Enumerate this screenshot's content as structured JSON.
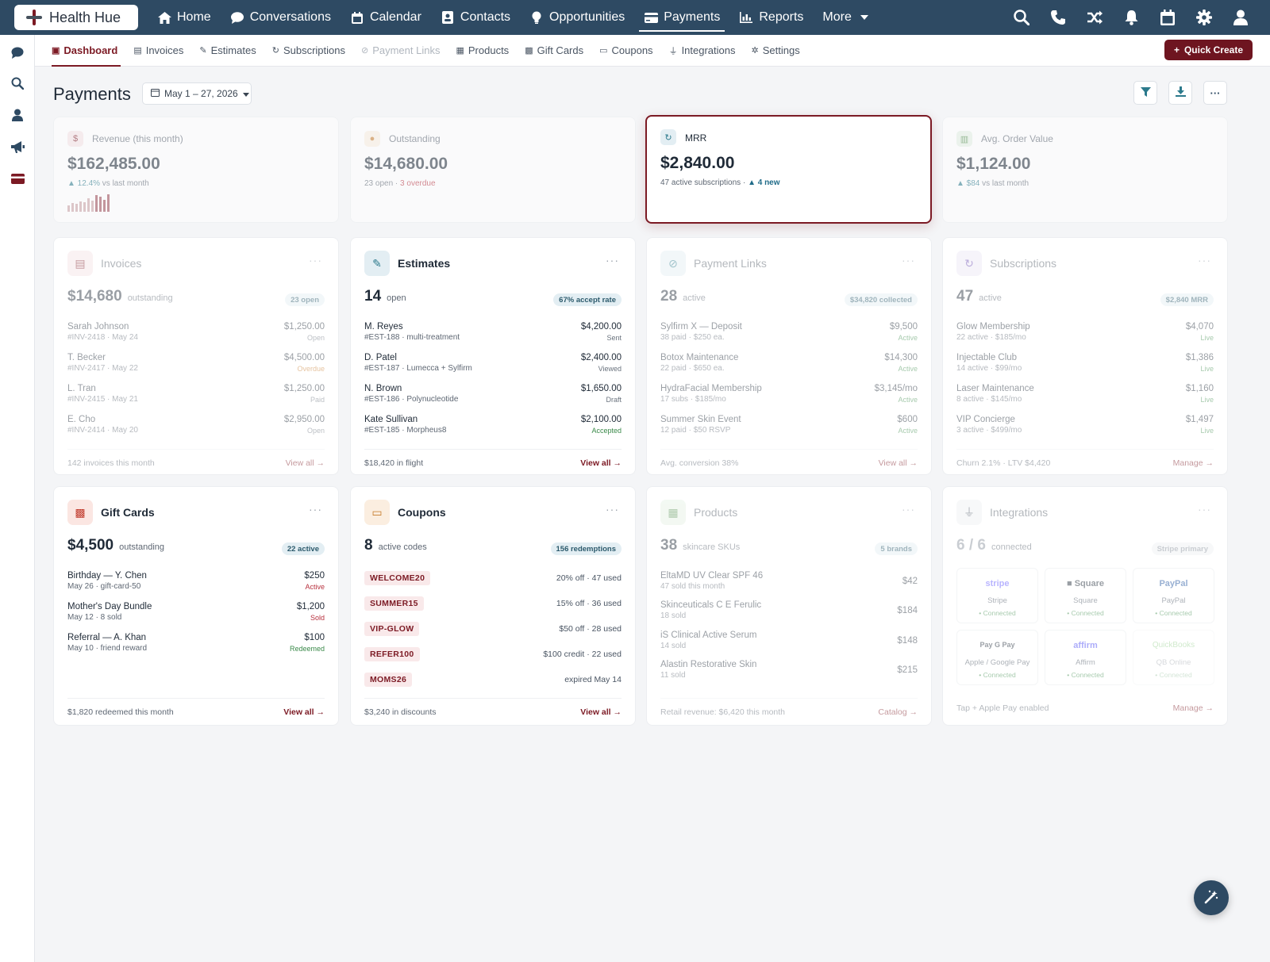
{
  "brand": {
    "name": "Health Hue"
  },
  "topnav": {
    "items": [
      {
        "label": "Home",
        "icon": "home-icon"
      },
      {
        "label": "Conversations",
        "icon": "chat-icon"
      },
      {
        "label": "Calendar",
        "icon": "calendar-icon"
      },
      {
        "label": "Contacts",
        "icon": "contact-card-icon"
      },
      {
        "label": "Opportunities",
        "icon": "lightbulb-icon"
      },
      {
        "label": "Payments",
        "icon": "credit-card-icon",
        "active": true
      },
      {
        "label": "Reports",
        "icon": "bar-chart-icon"
      },
      {
        "label": "More",
        "icon": "caret-down-icon"
      }
    ],
    "actions": [
      "search-icon",
      "phone-icon",
      "shuffle-icon",
      "bell-icon",
      "calendar-icon",
      "gear-icon",
      "user-icon"
    ]
  },
  "subnav": {
    "items": [
      {
        "label": "Dashboard",
        "active": true
      },
      {
        "label": "Invoices"
      },
      {
        "label": "Estimates"
      },
      {
        "label": "Subscriptions"
      },
      {
        "label": "Payment Links",
        "dim": true
      },
      {
        "label": "Products"
      },
      {
        "label": "Gift Cards"
      },
      {
        "label": "Coupons"
      },
      {
        "label": "Integrations"
      },
      {
        "label": "Settings"
      }
    ],
    "quick_create": "Quick Create"
  },
  "page": {
    "title": "Payments",
    "date_range": "May 1 – 27, 2026"
  },
  "kpis": {
    "revenue": {
      "label": "Revenue (this month)",
      "value": "$162,485.00",
      "delta": "▲ 12.4%",
      "delta_suffix": " vs last month",
      "spark": [
        0.35,
        0.5,
        0.45,
        0.6,
        0.55,
        0.75,
        0.65,
        0.95,
        0.85,
        0.7,
        1.0
      ]
    },
    "outstanding": {
      "label": "Outstanding",
      "value": "$14,680.00",
      "sub": "23 open · ",
      "overdue": "3 overdue"
    },
    "mrr": {
      "label": "MRR",
      "value": "$2,840.00",
      "sub": "47 active subscriptions · ",
      "new": "▲ 4 new"
    },
    "aov": {
      "label": "Avg. Order Value",
      "value": "$1,124.00",
      "delta": "▲ $84",
      "delta_suffix": " vs last month"
    }
  },
  "invoices": {
    "title": "Invoices",
    "big": "$14,680",
    "big_sub": "outstanding",
    "pill": "23 open",
    "rows": [
      {
        "name": "Sarah Johnson",
        "meta": "#INV-2418 · May 24",
        "amount": "$1,250.00",
        "status": "Open"
      },
      {
        "name": "T. Becker",
        "meta": "#INV-2417 · May 22",
        "amount": "$4,500.00",
        "status": "Overdue"
      },
      {
        "name": "L. Tran",
        "meta": "#INV-2415 · May 21",
        "amount": "$1,250.00",
        "status": "Paid"
      },
      {
        "name": "E. Cho",
        "meta": "#INV-2414 · May 20",
        "amount": "$2,950.00",
        "status": "Open"
      }
    ],
    "foot_left": "142 invoices this month",
    "foot_right": "View all →"
  },
  "estimates": {
    "title": "Estimates",
    "big": "14",
    "big_sub": "open",
    "pill": "67% accept rate",
    "rows": [
      {
        "name": "M. Reyes",
        "meta": "#EST-188 · multi-treatment",
        "amount": "$4,200.00",
        "status": "Sent"
      },
      {
        "name": "D. Patel",
        "meta": "#EST-187 · Lumecca + Sylfirm",
        "amount": "$2,400.00",
        "status": "Viewed"
      },
      {
        "name": "N. Brown",
        "meta": "#EST-186 · Polynucleotide",
        "amount": "$1,650.00",
        "status": "Draft"
      },
      {
        "name": "Kate Sullivan",
        "meta": "#EST-185 · Morpheus8",
        "amount": "$2,100.00",
        "status": "Accepted"
      }
    ],
    "foot_left": "$18,420 in flight",
    "foot_right": "View all →"
  },
  "payment_links": {
    "title": "Payment Links",
    "big": "28",
    "big_sub": "active",
    "pill": "$34,820 collected",
    "rows": [
      {
        "name": "Sylfirm X — Deposit",
        "meta": "38 paid · $250 ea.",
        "amount": "$9,500",
        "status": "Active"
      },
      {
        "name": "Botox Maintenance",
        "meta": "22 paid · $650 ea.",
        "amount": "$14,300",
        "status": "Active"
      },
      {
        "name": "HydraFacial Membership",
        "meta": "17 subs · $185/mo",
        "amount": "$3,145/mo",
        "status": "Active"
      },
      {
        "name": "Summer Skin Event",
        "meta": "12 paid · $50 RSVP",
        "amount": "$600",
        "status": "Active"
      }
    ],
    "foot_left": "Avg. conversion 38%",
    "foot_right": "View all →"
  },
  "subscriptions": {
    "title": "Subscriptions",
    "big": "47",
    "big_sub": "active",
    "pill": "$2,840 MRR",
    "rows": [
      {
        "name": "Glow Membership",
        "meta": "22 active · $185/mo",
        "amount": "$4,070",
        "status": "Live"
      },
      {
        "name": "Injectable Club",
        "meta": "14 active · $99/mo",
        "amount": "$1,386",
        "status": "Live"
      },
      {
        "name": "Laser Maintenance",
        "meta": "8 active · $145/mo",
        "amount": "$1,160",
        "status": "Live"
      },
      {
        "name": "VIP Concierge",
        "meta": "3 active · $499/mo",
        "amount": "$1,497",
        "status": "Live"
      }
    ],
    "foot_left": "Churn 2.1% · LTV $4,420",
    "foot_right": "Manage →"
  },
  "gift_cards": {
    "title": "Gift Cards",
    "big": "$4,500",
    "big_sub": "outstanding",
    "pill": "22 active",
    "rows": [
      {
        "name": "Birthday — Y. Chen",
        "meta": "May 26 · gift-card-50",
        "amount": "$250",
        "status": "Active"
      },
      {
        "name": "Mother's Day Bundle",
        "meta": "May 12 · 8 sold",
        "amount": "$1,200",
        "status": "Sold"
      },
      {
        "name": "Referral — A. Khan",
        "meta": "May 10 · friend reward",
        "amount": "$100",
        "status": "Redeemed"
      }
    ],
    "foot_left": "$1,820 redeemed this month",
    "foot_right": "View all →"
  },
  "coupons": {
    "title": "Coupons",
    "big": "8",
    "big_sub": "active codes",
    "pill": "156 redemptions",
    "rows": [
      {
        "code": "WELCOME20",
        "detail": "20% off · 47 used"
      },
      {
        "code": "SUMMER15",
        "detail": "15% off · 36 used"
      },
      {
        "code": "VIP-GLOW",
        "detail": "$50 off · 28 used"
      },
      {
        "code": "REFER100",
        "detail": "$100 credit · 22 used"
      },
      {
        "code": "MOMS26",
        "detail": "expired May 14"
      }
    ],
    "foot_left": "$3,240 in discounts",
    "foot_right": "View all →"
  },
  "products": {
    "title": "Products",
    "big": "38",
    "big_sub": "skincare SKUs",
    "pill": "5 brands",
    "rows": [
      {
        "name": "EltaMD UV Clear SPF 46",
        "meta": "47 sold this month",
        "amount": "$42"
      },
      {
        "name": "Skinceuticals C E Ferulic",
        "meta": "18 sold",
        "amount": "$184"
      },
      {
        "name": "iS Clinical Active Serum",
        "meta": "14 sold",
        "amount": "$148"
      },
      {
        "name": "Alastin Restorative Skin",
        "meta": "11 sold",
        "amount": "$215"
      }
    ],
    "foot_left": "Retail revenue: $6,420 this month",
    "foot_right": "Catalog →"
  },
  "integrations": {
    "title": "Integrations",
    "big": "6 / 6",
    "big_sub": "connected",
    "pill": "Stripe primary",
    "tiles": [
      {
        "logo": "stripe",
        "name": "Stripe",
        "status": "• Connected",
        "color": "#635bff"
      },
      {
        "logo": "■ Square",
        "name": "Square",
        "status": "• Connected",
        "color": "#1f2a37"
      },
      {
        "logo": "PayPal",
        "name": "PayPal",
        "status": "• Connected",
        "color": "#1b4f9c"
      },
      {
        "logo": "Pay  G Pay",
        "name": "Apple / Google Pay",
        "status": "• Connected",
        "color": "#1f2a37"
      },
      {
        "logo": "affirm",
        "name": "Affirm",
        "status": "• Connected",
        "color": "#4a4af4"
      },
      {
        "logo": "QuickBooks",
        "name": "QB Online",
        "status": "• Connected",
        "color": "#2ca01c"
      }
    ],
    "foot_left": "Tap + Apple Pay enabled",
    "foot_right": "Manage →"
  },
  "colors": {
    "accent": "#7c1a24",
    "topbar": "#2e4a63",
    "teal": "#2c7a8c"
  }
}
